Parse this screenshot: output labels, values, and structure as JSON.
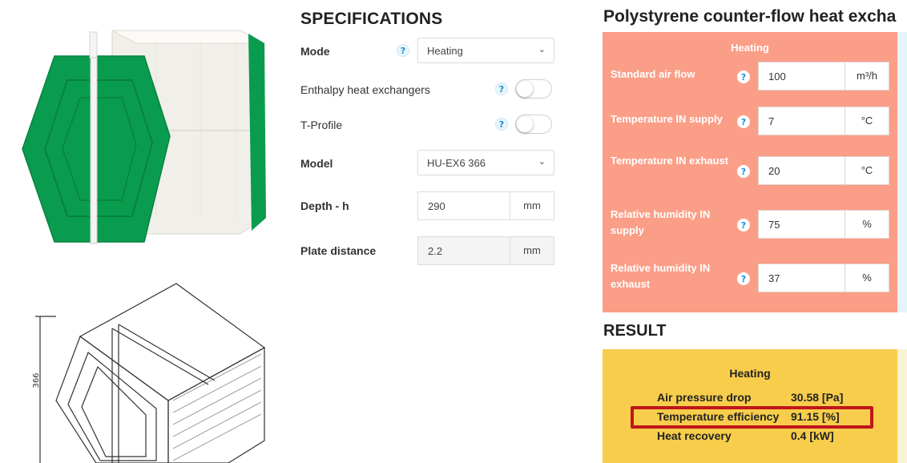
{
  "specifications": {
    "title": "SPECIFICATIONS",
    "mode": {
      "label": "Mode",
      "value": "Heating"
    },
    "enthalpy": {
      "label": "Enthalpy heat exchangers",
      "enabled": false
    },
    "tprofile": {
      "label": "T-Profile",
      "enabled": false
    },
    "model": {
      "label": "Model",
      "value": "HU-EX6 366"
    },
    "depth": {
      "label": "Depth - h",
      "value": "290",
      "unit": "mm"
    },
    "plate_distance": {
      "label": "Plate distance",
      "value": "2.2",
      "unit": "mm"
    },
    "help_glyph": "?"
  },
  "drawing": {
    "dimension_label": "366"
  },
  "calculator": {
    "title": "Polystyrene counter-flow heat excha",
    "input_heading": "Heating",
    "inputs": [
      {
        "label": "Standard air flow",
        "value": "100",
        "unit": "m³/h"
      },
      {
        "label": "Temperature IN supply",
        "value": "7",
        "unit": "°C"
      },
      {
        "label": "Temperature IN exhaust",
        "value": "20",
        "unit": "°C"
      },
      {
        "label": "Relative humidity IN supply",
        "value": "75",
        "unit": "%"
      },
      {
        "label": "Relative humidity IN exhaust",
        "value": "37",
        "unit": "%"
      }
    ]
  },
  "result": {
    "title": "RESULT",
    "heading": "Heating",
    "rows": [
      {
        "label": "Air pressure drop",
        "value": "30.58 [Pa]"
      },
      {
        "label": "Temperature efficiency",
        "value": "91.15 [%]",
        "highlighted": true
      },
      {
        "label": "Heat recovery",
        "value": "0.4 [kW]"
      }
    ]
  },
  "colors": {
    "input_panel": "#fb9e87",
    "result_panel": "#f7cd4b",
    "highlight_border": "#c0151b",
    "product_green": "#0a9c4e",
    "help_icon": "#1a8fd6"
  }
}
